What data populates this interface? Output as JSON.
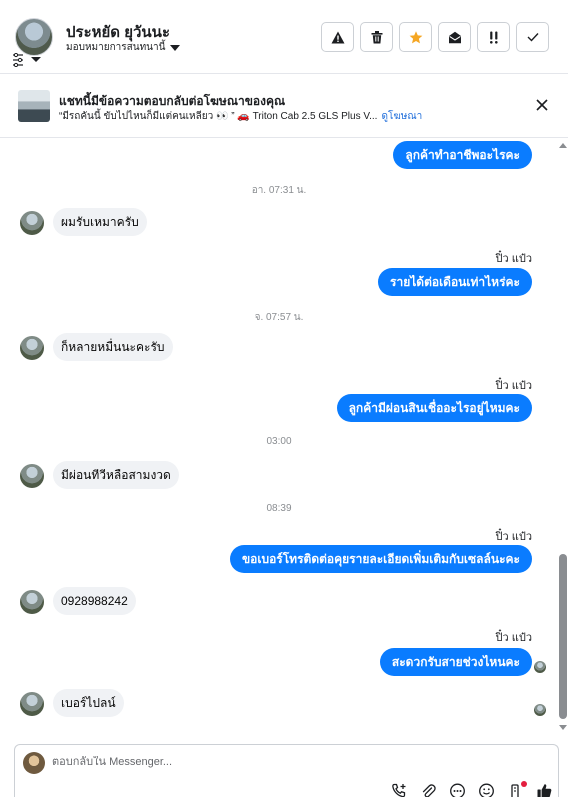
{
  "header": {
    "contact_name": "ประหยัด ยุวันนะ",
    "assign_label": "มอบหมายการสนทนานี้",
    "tools": [
      "spam-icon",
      "trash-icon",
      "star-icon",
      "mark-unread-icon",
      "follow-up-icon",
      "done-icon"
    ]
  },
  "ad": {
    "title": "แชทนี้มีข้อความตอบกลับต่อโฆษณาของคุณ",
    "subtitle": "“มีรถคันนี้ ขับไปไหนก็มีแต่คนเหลียว 👀 ” 🚗 Triton Cab 2.5 GLS Plus V...",
    "link": "ดูโฆษณา"
  },
  "messages": [
    {
      "type": "out",
      "text": "ลูกค้าทำอาชีพอะไรคะ"
    },
    {
      "type": "time",
      "text": "อา. 07:31 น."
    },
    {
      "type": "in",
      "text": "ผมรับเหมาครับ"
    },
    {
      "type": "sender",
      "text": "ปิ๋ว แป๋ว"
    },
    {
      "type": "out",
      "text": "รายได้ต่อเดือนเท่าไหร่คะ"
    },
    {
      "type": "time",
      "text": "จ. 07:57 น."
    },
    {
      "type": "in",
      "text": "ก็หลายหมื่นนะคะรับ"
    },
    {
      "type": "sender",
      "text": "ปิ๋ว แป๋ว"
    },
    {
      "type": "out",
      "text": "ลูกค้ามีผ่อนสินเชื่ออะไรอยู่ไหมคะ"
    },
    {
      "type": "time",
      "text": "03:00"
    },
    {
      "type": "in",
      "text": "มีผ่อนทีวีหลือสามงวด"
    },
    {
      "type": "time",
      "text": "08:39"
    },
    {
      "type": "sender",
      "text": "ปิ๋ว แป๋ว"
    },
    {
      "type": "out",
      "text": "ขอเบอร์โทรติดต่อคุยรายละเอียดเพิ่มเติมกับเซลล์นะคะ"
    },
    {
      "type": "in",
      "text": "0928988242"
    },
    {
      "type": "sender",
      "text": "ปิ๋ว แป๋ว"
    },
    {
      "type": "out",
      "text": "สะดวกรับสายช่วงไหนคะ"
    },
    {
      "type": "in",
      "text": "เบอร์ไปลน์"
    }
  ],
  "composer": {
    "placeholder": "ตอบกลับใน Messenger...",
    "tools": [
      "call-icon",
      "attachment-icon",
      "more-icon",
      "emoji-icon",
      "notes-icon",
      "like-icon"
    ]
  },
  "colors": {
    "accent": "#0a7cff",
    "incoming_bubble": "#f0f2f5",
    "favorite_star": "#f5a623"
  }
}
